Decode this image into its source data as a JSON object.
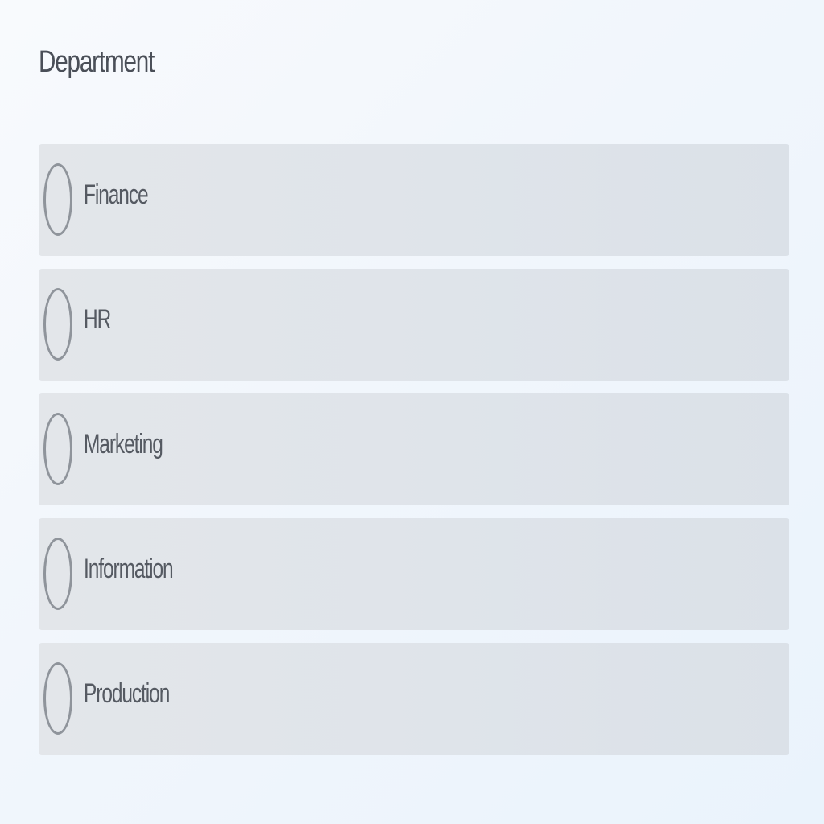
{
  "field": {
    "label": "Department",
    "options": [
      {
        "label": "Finance",
        "selected": false
      },
      {
        "label": "HR",
        "selected": false
      },
      {
        "label": "Marketing",
        "selected": false
      },
      {
        "label": "Information",
        "selected": false
      },
      {
        "label": "Production",
        "selected": false
      }
    ]
  },
  "colors": {
    "option_background": "#dfe4ea",
    "radio_border": "#8f949b",
    "text": "#4a4f58"
  }
}
